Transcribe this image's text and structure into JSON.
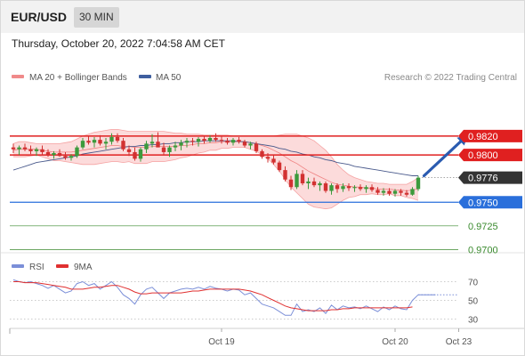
{
  "header": {
    "symbol": "EUR/USD",
    "interval": "30 MIN",
    "datetime": "Thursday, October 20, 2022 7:04:58 AM CET"
  },
  "legend": {
    "bollinger_label": "MA 20 + Bollinger Bands",
    "ma50_label": "MA 50",
    "research": "Research © 2022 Trading Central"
  },
  "colors": {
    "bull": "#3c9a3c",
    "bear": "#d23131",
    "resistance": "#e02020",
    "pivot": "#2a6fdb",
    "support": "#3a8a2e",
    "bands_fill": "#fbd5d5",
    "ma50": "#4a5a8c",
    "arrow": "#2a5bb0",
    "last_price_bg": "#333333",
    "rsi": "#7b8fd8",
    "rsi_ma": "#e03030"
  },
  "chart_data": [
    {
      "type": "candlestick",
      "title": "EUR/USD",
      "ylim": [
        0.969,
        0.985
      ],
      "x_labels": [
        {
          "index": 36,
          "text": "Oct 19"
        },
        {
          "index": 66,
          "text": "Oct 20"
        },
        {
          "index": 77,
          "text": "Oct 23"
        }
      ],
      "candles": [
        [
          0.9808,
          0.9812,
          0.9802,
          0.9806
        ],
        [
          0.9806,
          0.981,
          0.98,
          0.9808
        ],
        [
          0.9808,
          0.9812,
          0.9804,
          0.9806
        ],
        [
          0.9806,
          0.981,
          0.9801,
          0.9804
        ],
        [
          0.9804,
          0.9808,
          0.9799,
          0.9806
        ],
        [
          0.9806,
          0.981,
          0.98,
          0.9803
        ],
        [
          0.9803,
          0.9806,
          0.9798,
          0.98
        ],
        [
          0.98,
          0.9804,
          0.9796,
          0.9802
        ],
        [
          0.9802,
          0.9806,
          0.9798,
          0.9799
        ],
        [
          0.9799,
          0.9803,
          0.9795,
          0.9797
        ],
        [
          0.9797,
          0.9801,
          0.9794,
          0.9799
        ],
        [
          0.9799,
          0.981,
          0.9797,
          0.9808
        ],
        [
          0.9808,
          0.9818,
          0.9806,
          0.9815
        ],
        [
          0.9815,
          0.982,
          0.9811,
          0.9813
        ],
        [
          0.9813,
          0.9819,
          0.9808,
          0.9816
        ],
        [
          0.9816,
          0.9821,
          0.981,
          0.9812
        ],
        [
          0.9812,
          0.9818,
          0.9806,
          0.9814
        ],
        [
          0.9814,
          0.9823,
          0.9811,
          0.9819
        ],
        [
          0.9819,
          0.9823,
          0.9813,
          0.9815
        ],
        [
          0.9815,
          0.9818,
          0.9804,
          0.9806
        ],
        [
          0.9806,
          0.981,
          0.9799,
          0.9803
        ],
        [
          0.9803,
          0.9808,
          0.9794,
          0.9796
        ],
        [
          0.9796,
          0.9808,
          0.9793,
          0.9806
        ],
        [
          0.9806,
          0.9815,
          0.9802,
          0.9812
        ],
        [
          0.9812,
          0.9822,
          0.9808,
          0.9814
        ],
        [
          0.9814,
          0.9824,
          0.981,
          0.9808
        ],
        [
          0.9808,
          0.9813,
          0.98,
          0.9803
        ],
        [
          0.9803,
          0.981,
          0.9798,
          0.9808
        ],
        [
          0.9808,
          0.9814,
          0.9804,
          0.981
        ],
        [
          0.981,
          0.9816,
          0.9805,
          0.9813
        ],
        [
          0.9813,
          0.9818,
          0.9808,
          0.9815
        ],
        [
          0.9815,
          0.9818,
          0.981,
          0.9814
        ],
        [
          0.9814,
          0.9819,
          0.9809,
          0.9817
        ],
        [
          0.9817,
          0.982,
          0.9812,
          0.9815
        ],
        [
          0.9815,
          0.9821,
          0.9813,
          0.9818
        ],
        [
          0.9818,
          0.9823,
          0.9814,
          0.9816
        ],
        [
          0.9816,
          0.982,
          0.9812,
          0.9815
        ],
        [
          0.9815,
          0.9818,
          0.9811,
          0.9813
        ],
        [
          0.9813,
          0.9818,
          0.981,
          0.9816
        ],
        [
          0.9816,
          0.9819,
          0.9812,
          0.9814
        ],
        [
          0.9814,
          0.9816,
          0.9808,
          0.981
        ],
        [
          0.981,
          0.9814,
          0.9806,
          0.9812
        ],
        [
          0.9812,
          0.9814,
          0.9802,
          0.9804
        ],
        [
          0.9804,
          0.9806,
          0.9796,
          0.9798
        ],
        [
          0.9798,
          0.9802,
          0.9792,
          0.9796
        ],
        [
          0.9796,
          0.98,
          0.979,
          0.9792
        ],
        [
          0.9792,
          0.9794,
          0.9782,
          0.9784
        ],
        [
          0.9784,
          0.9788,
          0.9772,
          0.9774
        ],
        [
          0.9774,
          0.9778,
          0.9763,
          0.9766
        ],
        [
          0.9766,
          0.9784,
          0.9764,
          0.978
        ],
        [
          0.978,
          0.9784,
          0.9768,
          0.977
        ],
        [
          0.977,
          0.9776,
          0.9764,
          0.9772
        ],
        [
          0.9772,
          0.9776,
          0.9766,
          0.9768
        ],
        [
          0.9768,
          0.9772,
          0.9762,
          0.977
        ],
        [
          0.977,
          0.9772,
          0.976,
          0.9762
        ],
        [
          0.9762,
          0.977,
          0.9758,
          0.9768
        ],
        [
          0.9768,
          0.977,
          0.976,
          0.9764
        ],
        [
          0.9764,
          0.977,
          0.9761,
          0.9767
        ],
        [
          0.9767,
          0.977,
          0.9762,
          0.9765
        ],
        [
          0.9765,
          0.9768,
          0.9761,
          0.9766
        ],
        [
          0.9766,
          0.9769,
          0.9762,
          0.9764
        ],
        [
          0.9764,
          0.9768,
          0.976,
          0.9766
        ],
        [
          0.9766,
          0.9769,
          0.9761,
          0.9763
        ],
        [
          0.9763,
          0.9766,
          0.9758,
          0.976
        ],
        [
          0.976,
          0.9765,
          0.9757,
          0.9762
        ],
        [
          0.9762,
          0.9765,
          0.9757,
          0.9759
        ],
        [
          0.9759,
          0.9764,
          0.9756,
          0.9762
        ],
        [
          0.9762,
          0.9764,
          0.9757,
          0.976
        ],
        [
          0.976,
          0.9763,
          0.9756,
          0.9758
        ],
        [
          0.9758,
          0.9766,
          0.9757,
          0.9764
        ],
        [
          0.9764,
          0.9778,
          0.9762,
          0.9776
        ]
      ],
      "bollinger": {
        "mid": [
          0.9805,
          0.9806,
          0.9806,
          0.9806,
          0.9806,
          0.9805,
          0.9804,
          0.9803,
          0.9803,
          0.9803,
          0.9803,
          0.9804,
          0.9805,
          0.9806,
          0.9807,
          0.9808,
          0.9809,
          0.981,
          0.981,
          0.9809,
          0.9809,
          0.9808,
          0.9808,
          0.9808,
          0.9809,
          0.9809,
          0.9809,
          0.9809,
          0.9809,
          0.981,
          0.981,
          0.9811,
          0.9812,
          0.9812,
          0.9813,
          0.9813,
          0.9814,
          0.9814,
          0.9814,
          0.9814,
          0.9814,
          0.9813,
          0.9812,
          0.981,
          0.9808,
          0.9805,
          0.9802,
          0.9798,
          0.9794,
          0.9791,
          0.9787,
          0.9783,
          0.978,
          0.9777,
          0.9774,
          0.9771,
          0.9769,
          0.9768,
          0.9767,
          0.9766,
          0.9766,
          0.9765,
          0.9765,
          0.9764,
          0.9764,
          0.9764,
          0.9763,
          0.9763,
          0.9762,
          0.9763,
          0.9764
        ],
        "upper": [
          0.9812,
          0.9814,
          0.9814,
          0.9813,
          0.9812,
          0.9812,
          0.9812,
          0.9812,
          0.9812,
          0.9813,
          0.9814,
          0.9817,
          0.982,
          0.9822,
          0.9824,
          0.9825,
          0.9826,
          0.9827,
          0.9827,
          0.9826,
          0.9825,
          0.9825,
          0.9825,
          0.9825,
          0.9825,
          0.9825,
          0.9825,
          0.9824,
          0.9823,
          0.9823,
          0.9822,
          0.9822,
          0.9822,
          0.9821,
          0.9821,
          0.9821,
          0.9821,
          0.9821,
          0.982,
          0.982,
          0.982,
          0.982,
          0.982,
          0.982,
          0.982,
          0.982,
          0.9821,
          0.9822,
          0.9822,
          0.9822,
          0.982,
          0.9818,
          0.9815,
          0.981,
          0.9805,
          0.9798,
          0.979,
          0.9784,
          0.9779,
          0.9776,
          0.9774,
          0.9772,
          0.9771,
          0.977,
          0.977,
          0.9769,
          0.9769,
          0.9769,
          0.9769,
          0.9772,
          0.9776
        ],
        "lower": [
          0.9798,
          0.9798,
          0.9798,
          0.9799,
          0.98,
          0.9798,
          0.9796,
          0.9794,
          0.9794,
          0.9793,
          0.9792,
          0.9791,
          0.979,
          0.979,
          0.979,
          0.9791,
          0.9792,
          0.9793,
          0.9793,
          0.9792,
          0.9793,
          0.9791,
          0.9791,
          0.9791,
          0.9793,
          0.9793,
          0.9793,
          0.9794,
          0.9795,
          0.9797,
          0.9798,
          0.98,
          0.9802,
          0.9803,
          0.9805,
          0.9805,
          0.9807,
          0.9807,
          0.9808,
          0.9808,
          0.9808,
          0.9806,
          0.9804,
          0.98,
          0.9796,
          0.979,
          0.9783,
          0.9774,
          0.9766,
          0.976,
          0.9754,
          0.9748,
          0.9745,
          0.9744,
          0.9743,
          0.9744,
          0.9748,
          0.9752,
          0.9755,
          0.9756,
          0.9758,
          0.9758,
          0.9759,
          0.9758,
          0.9758,
          0.9759,
          0.9757,
          0.9757,
          0.9755,
          0.9754,
          0.9752
        ]
      },
      "ma50": [
        0.9784,
        0.9786,
        0.9788,
        0.979,
        0.9792,
        0.9793,
        0.9794,
        0.9795,
        0.9796,
        0.9797,
        0.9798,
        0.9799,
        0.9801,
        0.9802,
        0.9803,
        0.9804,
        0.9805,
        0.9806,
        0.9807,
        0.9808,
        0.9809,
        0.9809,
        0.981,
        0.981,
        0.9811,
        0.9811,
        0.9812,
        0.9812,
        0.9813,
        0.9813,
        0.9814,
        0.9814,
        0.9814,
        0.9815,
        0.9815,
        0.9815,
        0.9815,
        0.9815,
        0.9815,
        0.9814,
        0.9814,
        0.9813,
        0.9812,
        0.9811,
        0.981,
        0.9809,
        0.9807,
        0.9806,
        0.9804,
        0.9803,
        0.9801,
        0.98,
        0.9798,
        0.9797,
        0.9795,
        0.9794,
        0.9792,
        0.9791,
        0.979,
        0.9788,
        0.9787,
        0.9786,
        0.9785,
        0.9784,
        0.9783,
        0.9782,
        0.9781,
        0.978,
        0.9779,
        0.9778,
        0.9778
      ],
      "levels": [
        {
          "value": 0.982,
          "label": "0.9820",
          "kind": "resistance"
        },
        {
          "value": 0.98,
          "label": "0.9800",
          "kind": "resistance"
        },
        {
          "value": 0.9776,
          "label": "0.9776",
          "kind": "last"
        },
        {
          "value": 0.975,
          "label": "0.9750",
          "kind": "pivot"
        },
        {
          "value": 0.9725,
          "label": "0.9725",
          "kind": "support"
        },
        {
          "value": 0.97,
          "label": "0.9700",
          "kind": "support"
        }
      ],
      "forecast_arrow": {
        "from_index": 71,
        "from_value": 0.9778,
        "to_index": 78,
        "to_value": 0.9818
      }
    },
    {
      "type": "line",
      "legend": [
        "RSI",
        "9MA"
      ],
      "ylim": [
        20,
        80
      ],
      "y_ticks": [
        70,
        50,
        30
      ],
      "rsi": [
        72,
        70,
        69,
        70,
        68,
        66,
        63,
        66,
        62,
        58,
        60,
        68,
        70,
        66,
        68,
        62,
        66,
        70,
        64,
        56,
        52,
        46,
        56,
        62,
        64,
        58,
        52,
        58,
        60,
        62,
        63,
        62,
        64,
        62,
        65,
        63,
        62,
        60,
        62,
        61,
        56,
        58,
        52,
        46,
        44,
        42,
        38,
        34,
        34,
        46,
        38,
        40,
        38,
        42,
        36,
        45,
        40,
        44,
        42,
        43,
        41,
        44,
        41,
        38,
        43,
        40,
        44,
        41,
        40,
        50,
        56,
        56,
        56,
        56
      ],
      "rsi_ma": [
        70,
        70,
        69,
        69,
        69,
        68,
        67,
        66,
        65,
        64,
        62,
        62,
        62,
        63,
        64,
        64,
        65,
        66,
        66,
        64,
        62,
        59,
        57,
        57,
        58,
        58,
        58,
        58,
        58,
        58,
        59,
        60,
        60,
        61,
        62,
        62,
        62,
        62,
        62,
        62,
        61,
        60,
        58,
        56,
        53,
        50,
        47,
        44,
        42,
        41,
        40,
        39,
        39,
        39,
        39,
        40,
        40,
        41,
        41,
        42,
        42,
        42,
        42,
        42,
        42,
        42,
        42,
        42,
        42,
        43
      ]
    }
  ]
}
